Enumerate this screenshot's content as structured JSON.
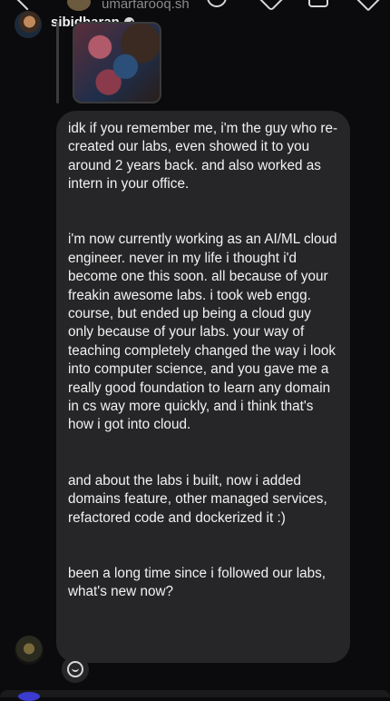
{
  "header": {
    "replied_to_username": "umarfarooq.sh",
    "username": "sibidharan",
    "icons": [
      "back-icon",
      "call-icon",
      "video-icon",
      "info-icon",
      "flag-icon"
    ]
  },
  "message": {
    "paragraphs": [
      "idk if you remember me, i'm the guy who re-created our labs, even showed it to you around 2 years back. and also worked as intern in your office.",
      "i'm now currently working as an AI/ML cloud engineer. never in my life i thought i'd become one this soon. all because of your freakin awesome labs. i took web engg. course, but ended up being a cloud guy only because of your labs. your way of teaching completely changed the way i look into computer science, and you gave me a really good foundation to learn any domain in cs way more quickly, and i think that's how i got into cloud.",
      "and about the labs i built, now i added domains feature, other managed services, refactored code and dockerized it :)",
      "been a long time since i followed our labs, what's new now?"
    ]
  },
  "colors": {
    "background": "#0b0b0d",
    "bubble": "#262628",
    "text": "#f2f2f2",
    "muted": "#8a8a8e"
  }
}
